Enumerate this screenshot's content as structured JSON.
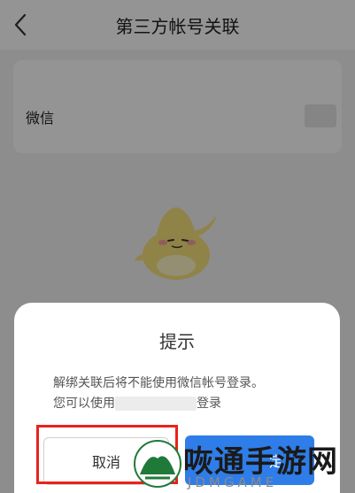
{
  "header": {
    "title": "第三方帐号关联",
    "back_icon": "chevron-left-icon"
  },
  "account": {
    "label": "微信"
  },
  "dialog": {
    "title": "提示",
    "message_line1": "解绑关联后将不能使用微信帐号登录。",
    "message_line2_prefix": "您可以使用",
    "message_line2_suffix": "登录",
    "cancel_label": "取消",
    "confirm_label": "定"
  },
  "watermark": {
    "title": "咴通手游网",
    "subtitle": "JDMGAME"
  },
  "colors": {
    "overlay": "#6f6f6f",
    "confirm_blue": "#2f7de8",
    "highlight_red": "#e8231c"
  }
}
